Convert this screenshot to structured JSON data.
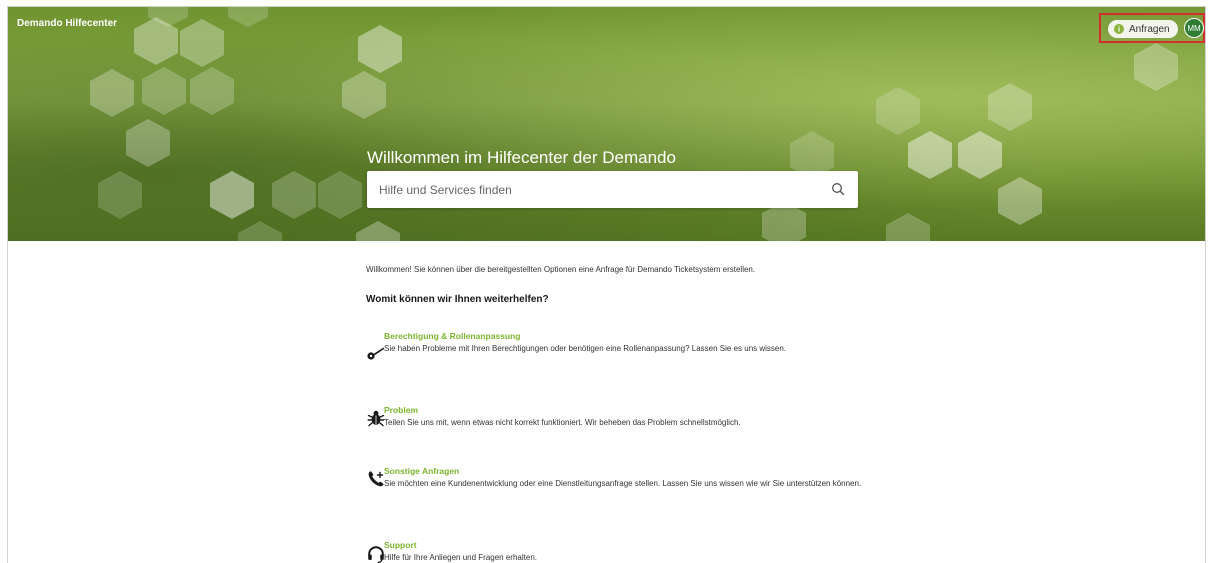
{
  "header": {
    "brand": "Demando Hilfecenter",
    "requests_label": "Anfragen",
    "avatar_initials": "MM",
    "accent_color": "#8ab43a",
    "avatar_color": "#2e7d32",
    "highlight_color": "#d32f2f"
  },
  "hero": {
    "title": "Willkommen im Hilfecenter der Demando",
    "search_placeholder": "Hilfe und Services finden"
  },
  "main": {
    "intro": "Willkommen! Sie können über die bereitgestellten Optionen eine Anfrage für Demando Ticketsystem erstellen.",
    "section_title": "Womit können wir Ihnen weiterhelfen?",
    "link_color": "#7cb52d",
    "items": [
      {
        "icon": "key-icon",
        "title": "Berechtigung & Rollenanpassung",
        "description": "Sie haben Probleme mit Ihren Berechtigungen oder benötigen eine Rollenanpassung? Lassen Sie es uns wissen."
      },
      {
        "icon": "bug-icon",
        "title": "Problem",
        "description": "Teilen Sie uns mit, wenn etwas nicht korrekt funktioniert. Wir beheben das Problem schnellstmöglich."
      },
      {
        "icon": "phone-plus-icon",
        "title": "Sonstige Anfragen",
        "description": "Sie möchten eine Kundenentwicklung oder eine Dienstleitungsanfrage stellen. Lassen Sie uns wissen wie wir Sie unterstützen können."
      },
      {
        "icon": "headset-icon",
        "title": "Support",
        "description": "Hilfe für Ihre Anliegen und Fragen erhalten."
      }
    ]
  }
}
